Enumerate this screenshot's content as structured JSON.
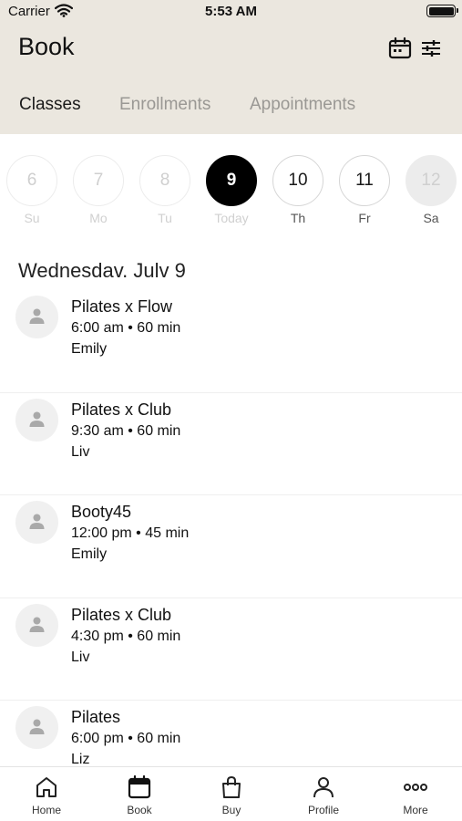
{
  "status_bar": {
    "carrier": "Carrier",
    "time": "5:53 AM"
  },
  "header": {
    "title": "Book"
  },
  "tabs": [
    {
      "label": "Classes",
      "active": true
    },
    {
      "label": "Enrollments",
      "active": false
    },
    {
      "label": "Appointments",
      "active": false
    }
  ],
  "dates": [
    {
      "num": "6",
      "dow": "Su",
      "state": "past"
    },
    {
      "num": "7",
      "dow": "Mo",
      "state": "past"
    },
    {
      "num": "8",
      "dow": "Tu",
      "state": "past"
    },
    {
      "num": "9",
      "dow": "Today",
      "state": "today"
    },
    {
      "num": "10",
      "dow": "Th",
      "state": "upcoming"
    },
    {
      "num": "11",
      "dow": "Fr",
      "state": "upcoming"
    },
    {
      "num": "12",
      "dow": "Sa",
      "state": "grey"
    }
  ],
  "day_heading": "Wednesdav. Julv 9",
  "classes": [
    {
      "name": "Pilates x Flow",
      "meta": "6:00 am • 60 min",
      "instructor": "Emily"
    },
    {
      "name": "Pilates x Club",
      "meta": "9:30 am • 60 min",
      "instructor": "Liv"
    },
    {
      "name": "Booty45",
      "meta": "12:00 pm • 45 min",
      "instructor": "Emily"
    },
    {
      "name": "Pilates x Club",
      "meta": "4:30 pm • 60 min",
      "instructor": "Liv"
    },
    {
      "name": "Pilates",
      "meta": "6:00 pm • 60 min",
      "instructor": "Liz"
    }
  ],
  "tabbar": {
    "home": "Home",
    "book": "Book",
    "buy": "Buy",
    "profile": "Profile",
    "more": "More"
  }
}
